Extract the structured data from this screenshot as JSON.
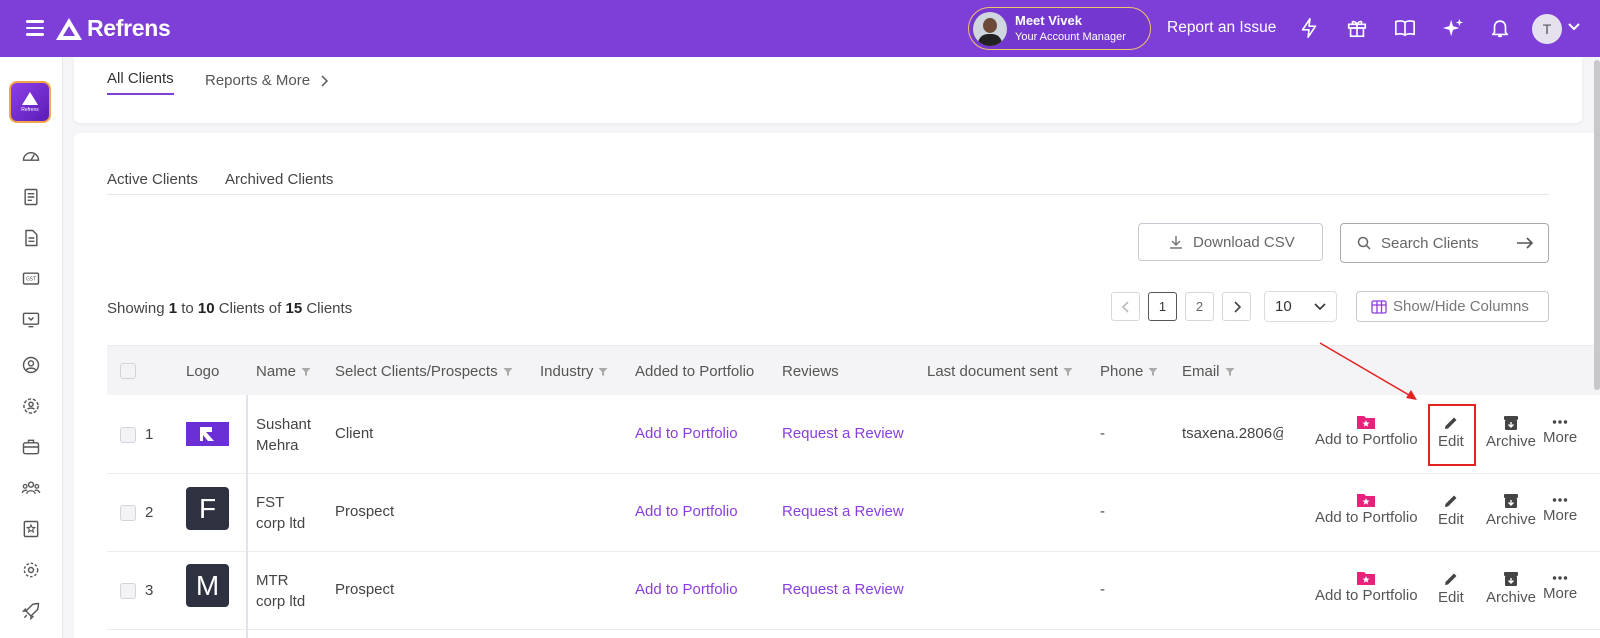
{
  "header": {
    "brand": "Refrens",
    "account_manager": {
      "name": "Meet Vivek",
      "role": "Your Account Manager"
    },
    "report_issue": "Report an Issue",
    "user_initial": "T"
  },
  "top_tabs": [
    {
      "label": "All Clients"
    },
    {
      "label": "Reports & More"
    }
  ],
  "sub_tabs": [
    {
      "label": "Active Clients"
    },
    {
      "label": "Archived Clients"
    }
  ],
  "toolbar": {
    "download_csv": "Download CSV",
    "search_placeholder": "Search Clients",
    "show_hide_columns": "Show/Hide Columns",
    "per_page": "10"
  },
  "showing": {
    "prefix": "Showing",
    "from": "1",
    "to_word": "to",
    "to": "10",
    "clients_of": "Clients of",
    "total": "15",
    "suffix": "Clients"
  },
  "pagination": {
    "pages": [
      "1",
      "2"
    ],
    "current": "1"
  },
  "columns": [
    "Logo",
    "Name",
    "Select Clients/Prospects",
    "Industry",
    "Added to Portfolio",
    "Reviews",
    "Last document sent",
    "Phone",
    "Email"
  ],
  "rows": [
    {
      "num": "1",
      "name_line1": "Sushant",
      "name_line2": "Mehra",
      "type": "Client",
      "portfolio": "Add to Portfolio",
      "review": "Request a Review",
      "phone": "-",
      "email": "tsaxena.2806@",
      "logo": ""
    },
    {
      "num": "2",
      "name_line1": "FST",
      "name_line2": "corp ltd",
      "type": "Prospect",
      "portfolio": "Add to Portfolio",
      "review": "Request a Review",
      "phone": "-",
      "email": "",
      "logo": "F"
    },
    {
      "num": "3",
      "name_line1": "MTR",
      "name_line2": "corp ltd",
      "type": "Prospect",
      "portfolio": "Add to Portfolio",
      "review": "Request a Review",
      "phone": "-",
      "email": "",
      "logo": "M"
    }
  ],
  "row_actions": {
    "add_portfolio": "Add to Portfolio",
    "edit": "Edit",
    "archive": "Archive",
    "more": "More"
  },
  "colors": {
    "brand": "#7e3fd9",
    "link": "#8a3ee0",
    "highlight": "#e52222",
    "portfolio_icon": "#e8217a"
  }
}
